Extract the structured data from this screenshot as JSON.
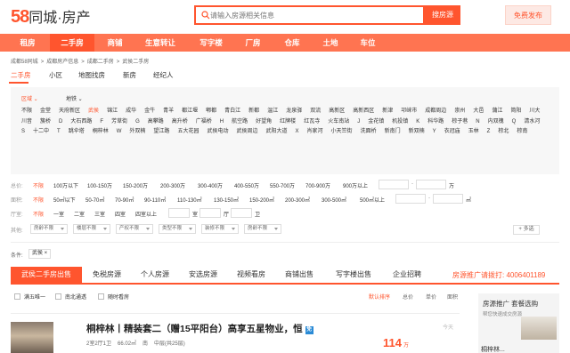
{
  "header": {
    "logo_num": "58",
    "logo_text": "同城·房产",
    "search_placeholder": "请输入房源相关信息",
    "search_button": "搜房源",
    "publish_button": "免费发布"
  },
  "nav": [
    "租房",
    "二手房",
    "商铺",
    "生意转让",
    "写字楼",
    "厂房",
    "仓库",
    "土地",
    "车位"
  ],
  "breadcrumb": [
    "成都58同城",
    ">",
    "成都房产信息",
    ">",
    "成都二手房",
    ">",
    "武侯二手房"
  ],
  "tabs": [
    "二手房",
    "小区",
    "地图找房",
    "新房",
    "经纪人"
  ],
  "filter_tabs": [
    "区域",
    "地铁"
  ],
  "areas": [
    "不限",
    "金堂",
    "天府新区",
    "武侯",
    "锦江",
    "成华",
    "金牛",
    "青羊",
    "都江堰",
    "郫都",
    "青白江",
    "新都",
    "温江",
    "龙泉驿",
    "双流",
    "高新区",
    "高新西区",
    "新津",
    "邛崃市",
    "成都周边",
    "崇州",
    "大邑",
    "蒲江",
    "简阳",
    "川大",
    "川音",
    "簇桥",
    "D",
    "大石西路",
    "F",
    "芳草街",
    "G",
    "高攀路",
    "高升桥",
    "广福桥",
    "H",
    "航空路",
    "好望角",
    "红牌楼",
    "红瓦寺",
    "火车南站",
    "J",
    "金花镇",
    "机投镇",
    "K",
    "科华路",
    "棕子巷",
    "N",
    "内双槐",
    "Q",
    "清水河",
    "S",
    "十二中",
    "T",
    "跳伞塔",
    "桐梓林",
    "W",
    "外双楠",
    "望江路",
    "五大花园",
    "武侯电动",
    "武侯周边",
    "武阳大道",
    "X",
    "肖家河",
    "小天竺街",
    "洗面桥",
    "新南门",
    "新双楠",
    "Y",
    "衣冠庙",
    "玉林",
    "Z",
    "棕北",
    "棕南"
  ],
  "price_row": {
    "label": "总价:",
    "options": [
      "不限",
      "100万以下",
      "100-150万",
      "150-200万",
      "200-300万",
      "300-400万",
      "400-550万",
      "550-700万",
      "700-900万",
      "900万以上"
    ],
    "unit": "万"
  },
  "area_row": {
    "label": "面积:",
    "options": [
      "不限",
      "50㎡以下",
      "50-70㎡",
      "70-90㎡",
      "90-110㎡",
      "110-130㎡",
      "130-150㎡",
      "150-200㎡",
      "200-300㎡",
      "300-500㎡",
      "500㎡以上"
    ],
    "unit": "㎡"
  },
  "room_row": {
    "label": "厅室:",
    "options": [
      "不限",
      "一室",
      "二室",
      "三室",
      "四室",
      "四室以上"
    ],
    "units": [
      "室",
      "厅",
      "卫"
    ]
  },
  "other_row": {
    "label": "其他:",
    "dropdowns": [
      "房龄不限",
      "楼层不限",
      "产权不限",
      "类型不限",
      "装修不限",
      "房龄不限"
    ],
    "more": "+ 多选"
  },
  "conditions": {
    "label": "条件:",
    "tag": "武侯 ×"
  },
  "list_tabs": [
    "武侯二手房出售",
    "免税房源",
    "个人房源",
    "安选房源",
    "视频看房",
    "商铺出售",
    "写字楼出售",
    "企业招聘"
  ],
  "hotline": "房源推广请拨打: 4006401189",
  "checks": [
    "满五唯一",
    "南北通透",
    "随时看房"
  ],
  "sorts": [
    "默认排序",
    "总价",
    "单价",
    "面积"
  ],
  "listing": {
    "title": "桐梓林丨精装套二（赠15平阳台）高享五星物业，恒",
    "badge": "免",
    "meta": [
      "2室2厅1卫",
      "66.02㎡",
      "南",
      "中层(共25层)"
    ],
    "price": "114",
    "price_unit": "万",
    "time": "今天"
  },
  "ad": {
    "title": "房源推广 套餐选购",
    "subtitle": "帮您快速成交房源",
    "name": "桐梓林..."
  }
}
